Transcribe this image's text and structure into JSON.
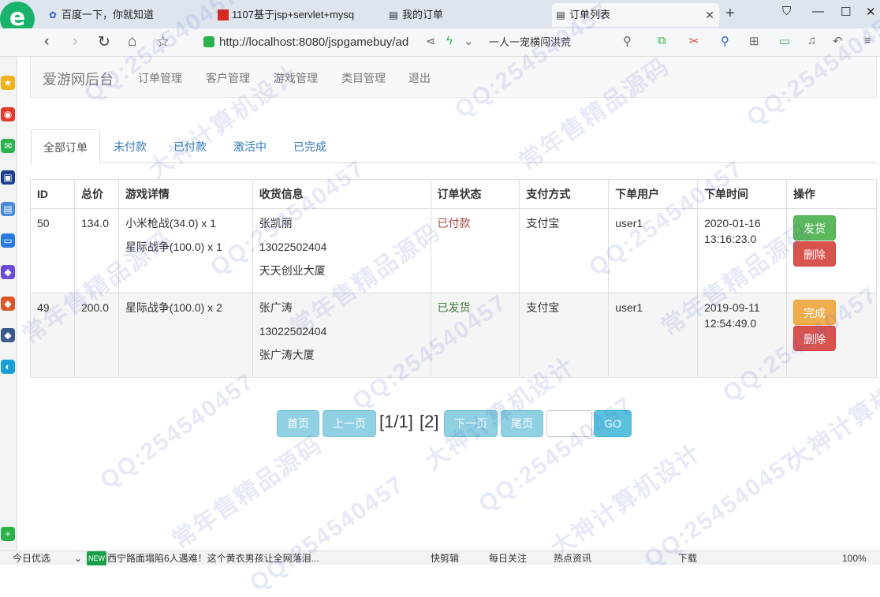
{
  "browser": {
    "tabs": [
      {
        "label": "百度一下，你就知道",
        "favicon": "baidu-paw-icon"
      },
      {
        "label": "1107基于jsp+servlet+mysq",
        "favicon": "red-square-icon"
      },
      {
        "label": "我的订单",
        "favicon": "page-icon"
      },
      {
        "label": "订单列表",
        "favicon": "page-icon",
        "active": true
      }
    ],
    "url": "http://localhost:8080/jspgamebuy/ad",
    "search_text": "一人一宠横闯洪荒",
    "status": {
      "left": "今日优选",
      "news_badge": "NEW",
      "news": "西宁路面塌陷6人遇难！这个黄衣男孩让全网落泪...",
      "items": [
        "快剪辑",
        "每日关注",
        "热点资讯",
        "下载"
      ],
      "zoom": "100%"
    }
  },
  "navbar": {
    "brand": "爱游网后台",
    "links": [
      "订单管理",
      "客户管理",
      "游戏管理",
      "类目管理",
      "退出"
    ]
  },
  "tabs": [
    "全部订单",
    "未付款",
    "已付款",
    "激活中",
    "已完成"
  ],
  "table": {
    "headers": [
      "ID",
      "总价",
      "游戏详情",
      "收货信息",
      "订单状态",
      "支付方式",
      "下单用户",
      "下单时间",
      "操作"
    ],
    "rows": [
      {
        "id": "50",
        "total": "134.0",
        "games": [
          "小米枪战(34.0) x 1",
          "星际战争(100.0) x 1"
        ],
        "name": "张凯丽",
        "phone": "13022502404",
        "address": "天天创业大厦",
        "status": "已付款",
        "payment": "支付宝",
        "user": "user1",
        "time_date": "2020-01-16",
        "time_clock": "13:16:23.0",
        "actions": [
          "发货",
          "删除"
        ]
      },
      {
        "id": "49",
        "total": "200.0",
        "games": [
          "星际战争(100.0) x 2"
        ],
        "name": "张广涛",
        "phone": "13022502404",
        "address": "张广涛大厦",
        "status": "已发货",
        "payment": "支付宝",
        "user": "user1",
        "time_date": "2019-09-11",
        "time_clock": "12:54:49.0",
        "actions": [
          "完成",
          "删除"
        ]
      }
    ]
  },
  "pager": {
    "first": "首页",
    "prev": "上一页",
    "current": "[1/1]",
    "page_link": "[2]",
    "next": "下一页",
    "last": "尾页",
    "go": "GO",
    "input_value": ""
  },
  "watermarks": [
    "QQ:254540457",
    "常年售精品源码",
    "大神计算机设计"
  ],
  "colors": {
    "paid": "#a94442",
    "shipped": "#3c763d",
    "success": "#5cb85c",
    "danger": "#d9534f",
    "warning": "#f0ad4e",
    "info": "#5bc0de"
  }
}
